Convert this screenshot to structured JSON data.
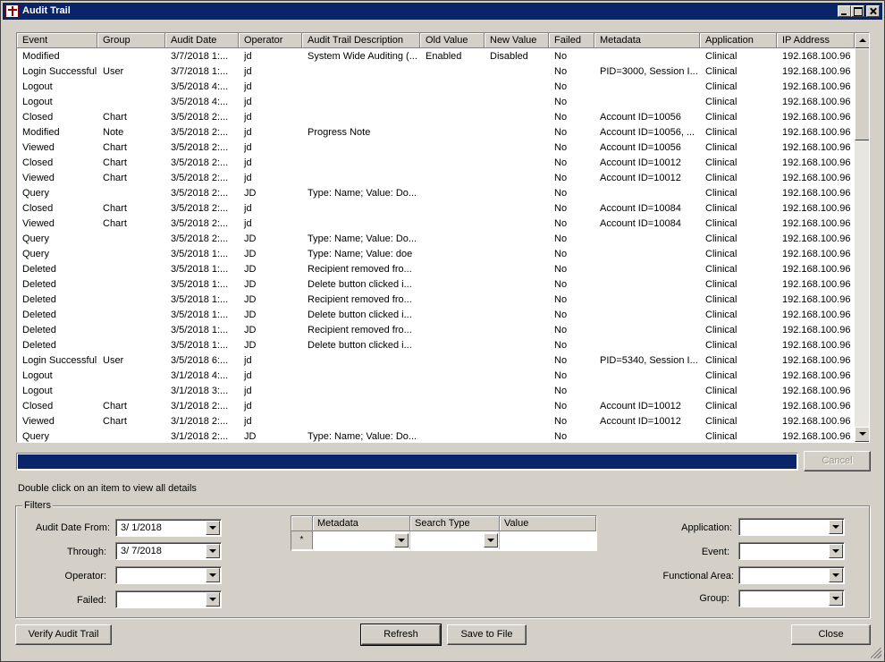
{
  "window": {
    "title": "Audit Trail"
  },
  "grid": {
    "columns": [
      "Event",
      "Group",
      "Audit Date",
      "Operator",
      "Audit Trail Description",
      "Old Value",
      "New Value",
      "Failed",
      "Metadata",
      "Application",
      "IP Address"
    ],
    "rows": [
      [
        "Modified",
        "",
        "3/7/2018 1:...",
        "jd",
        "System Wide Auditing (...",
        "Enabled",
        "Disabled",
        "No",
        "",
        "Clinical",
        "192.168.100.96"
      ],
      [
        "Login Successful",
        "User",
        "3/7/2018 1:...",
        "jd",
        "",
        "",
        "",
        "No",
        "PID=3000, Session I...",
        "Clinical",
        "192.168.100.96"
      ],
      [
        "Logout",
        "",
        "3/5/2018 4:...",
        "jd",
        "",
        "",
        "",
        "No",
        "",
        "Clinical",
        "192.168.100.96"
      ],
      [
        "Logout",
        "",
        "3/5/2018 4:...",
        "jd",
        "",
        "",
        "",
        "No",
        "",
        "Clinical",
        "192.168.100.96"
      ],
      [
        "Closed",
        "Chart",
        "3/5/2018 2:...",
        "jd",
        "",
        "",
        "",
        "No",
        "Account ID=10056",
        "Clinical",
        "192.168.100.96"
      ],
      [
        "Modified",
        "Note",
        "3/5/2018 2:...",
        "jd",
        "Progress Note",
        "",
        "",
        "No",
        "Account ID=10056, ...",
        "Clinical",
        "192.168.100.96"
      ],
      [
        "Viewed",
        "Chart",
        "3/5/2018 2:...",
        "jd",
        "",
        "",
        "",
        "No",
        "Account ID=10056",
        "Clinical",
        "192.168.100.96"
      ],
      [
        "Closed",
        "Chart",
        "3/5/2018 2:...",
        "jd",
        "",
        "",
        "",
        "No",
        "Account ID=10012",
        "Clinical",
        "192.168.100.96"
      ],
      [
        "Viewed",
        "Chart",
        "3/5/2018 2:...",
        "jd",
        "",
        "",
        "",
        "No",
        "Account ID=10012",
        "Clinical",
        "192.168.100.96"
      ],
      [
        "Query",
        "",
        "3/5/2018 2:...",
        "JD",
        "Type: Name; Value: Do...",
        "",
        "",
        "No",
        "",
        "Clinical",
        "192.168.100.96"
      ],
      [
        "Closed",
        "Chart",
        "3/5/2018 2:...",
        "jd",
        "",
        "",
        "",
        "No",
        "Account ID=10084",
        "Clinical",
        "192.168.100.96"
      ],
      [
        "Viewed",
        "Chart",
        "3/5/2018 2:...",
        "jd",
        "",
        "",
        "",
        "No",
        "Account ID=10084",
        "Clinical",
        "192.168.100.96"
      ],
      [
        "Query",
        "",
        "3/5/2018 2:...",
        "JD",
        "Type: Name; Value: Do...",
        "",
        "",
        "No",
        "",
        "Clinical",
        "192.168.100.96"
      ],
      [
        "Query",
        "",
        "3/5/2018 1:...",
        "JD",
        "Type: Name; Value: doe",
        "",
        "",
        "No",
        "",
        "Clinical",
        "192.168.100.96"
      ],
      [
        "Deleted",
        "",
        "3/5/2018 1:...",
        "JD",
        "Recipient removed fro...",
        "",
        "",
        "No",
        "",
        "Clinical",
        "192.168.100.96"
      ],
      [
        "Deleted",
        "",
        "3/5/2018 1:...",
        "JD",
        "Delete button clicked i...",
        "",
        "",
        "No",
        "",
        "Clinical",
        "192.168.100.96"
      ],
      [
        "Deleted",
        "",
        "3/5/2018 1:...",
        "JD",
        "Recipient removed fro...",
        "",
        "",
        "No",
        "",
        "Clinical",
        "192.168.100.96"
      ],
      [
        "Deleted",
        "",
        "3/5/2018 1:...",
        "JD",
        "Delete button clicked i...",
        "",
        "",
        "No",
        "",
        "Clinical",
        "192.168.100.96"
      ],
      [
        "Deleted",
        "",
        "3/5/2018 1:...",
        "JD",
        "Recipient removed fro...",
        "",
        "",
        "No",
        "",
        "Clinical",
        "192.168.100.96"
      ],
      [
        "Deleted",
        "",
        "3/5/2018 1:...",
        "JD",
        "Delete button clicked i...",
        "",
        "",
        "No",
        "",
        "Clinical",
        "192.168.100.96"
      ],
      [
        "Login Successful",
        "User",
        "3/5/2018 6:...",
        "jd",
        "",
        "",
        "",
        "No",
        "PID=5340, Session I...",
        "Clinical",
        "192.168.100.96"
      ],
      [
        "Logout",
        "",
        "3/1/2018 4:...",
        "jd",
        "",
        "",
        "",
        "No",
        "",
        "Clinical",
        "192.168.100.96"
      ],
      [
        "Logout",
        "",
        "3/1/2018 3:...",
        "jd",
        "",
        "",
        "",
        "No",
        "",
        "Clinical",
        "192.168.100.96"
      ],
      [
        "Closed",
        "Chart",
        "3/1/2018 2:...",
        "jd",
        "",
        "",
        "",
        "No",
        "Account ID=10012",
        "Clinical",
        "192.168.100.96"
      ],
      [
        "Viewed",
        "Chart",
        "3/1/2018 2:...",
        "jd",
        "",
        "",
        "",
        "No",
        "Account ID=10012",
        "Clinical",
        "192.168.100.96"
      ],
      [
        "Query",
        "",
        "3/1/2018 2:...",
        "JD",
        "Type: Name; Value: Do...",
        "",
        "",
        "No",
        "",
        "Clinical",
        "192.168.100.96"
      ]
    ]
  },
  "progress": {
    "fraction": 1.0,
    "color": "#0a246a",
    "cancel_label": "Cancel"
  },
  "hint": "Double click on an item to view all details",
  "filters": {
    "label": "Filters",
    "audit_date_from_label": "Audit Date From:",
    "audit_date_from_value": "3/  1/2018",
    "through_label": "Through:",
    "through_value": "3/  7/2018",
    "operator_label": "Operator:",
    "operator_value": "",
    "failed_label": "Failed:",
    "failed_value": "",
    "metadata_grid": {
      "columns": [
        "Metadata",
        "Search Type",
        "Value"
      ],
      "new_row_marker": "*"
    },
    "application_label": "Application:",
    "application_value": "",
    "event_label": "Event:",
    "event_value": "",
    "functional_area_label": "Functional Area:",
    "functional_area_value": "",
    "group_label": "Group:",
    "group_value": ""
  },
  "buttons": {
    "verify": "Verify Audit Trail",
    "refresh": "Refresh",
    "save": "Save to File",
    "close": "Close"
  },
  "colors": {
    "titlebar": "#0a246a",
    "face": "#d4d0c8"
  }
}
